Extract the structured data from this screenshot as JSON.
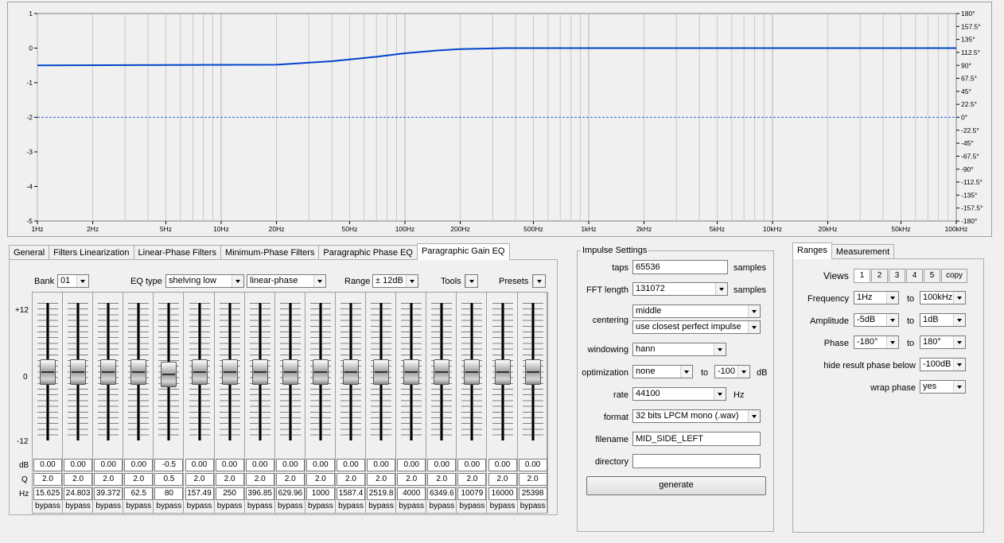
{
  "graph": {
    "y_left_ticks": [
      "1",
      "0",
      "-1",
      "-2",
      "-3",
      "-4",
      "-5"
    ],
    "y_right_ticks": [
      "180°",
      "157.5°",
      "135°",
      "112.5°",
      "90°",
      "67.5°",
      "45°",
      "22.5°",
      "0°",
      "-22.5°",
      "-45°",
      "-67.5°",
      "-90°",
      "-112.5°",
      "-135°",
      "-157.5°",
      "-180°"
    ],
    "x_ticks": [
      {
        "label": "1Hz",
        "hz": 1
      },
      {
        "label": "2Hz",
        "hz": 2
      },
      {
        "label": "5Hz",
        "hz": 5
      },
      {
        "label": "10Hz",
        "hz": 10
      },
      {
        "label": "20Hz",
        "hz": 20
      },
      {
        "label": "50Hz",
        "hz": 50
      },
      {
        "label": "100Hz",
        "hz": 100
      },
      {
        "label": "200Hz",
        "hz": 200
      },
      {
        "label": "500Hz",
        "hz": 500
      },
      {
        "label": "1kHz",
        "hz": 1000
      },
      {
        "label": "2kHz",
        "hz": 2000
      },
      {
        "label": "5kHz",
        "hz": 5000
      },
      {
        "label": "10kHz",
        "hz": 10000
      },
      {
        "label": "20kHz",
        "hz": 20000
      },
      {
        "label": "50kHz",
        "hz": 50000
      },
      {
        "label": "100kHz",
        "hz": 100000
      }
    ],
    "amplitude_curve": [
      [
        1,
        -0.5
      ],
      [
        20,
        -0.48
      ],
      [
        40,
        -0.38
      ],
      [
        70,
        -0.25
      ],
      [
        100,
        -0.15
      ],
      [
        150,
        -0.07
      ],
      [
        200,
        -0.03
      ],
      [
        300,
        -0.01
      ],
      [
        350,
        0
      ],
      [
        100000,
        0
      ]
    ],
    "phase_line_deg": 0,
    "colors": {
      "curve": "#0044cc",
      "phase": "#3366dd",
      "grid": "#c8c8c8",
      "plot_bg": "#f0f0f0"
    }
  },
  "left_tabs": [
    {
      "label": "General",
      "active": false
    },
    {
      "label": "Filters Linearization",
      "active": false
    },
    {
      "label": "Linear-Phase Filters",
      "active": false
    },
    {
      "label": "Minimum-Phase Filters",
      "active": false
    },
    {
      "label": "Paragraphic Phase EQ",
      "active": false
    },
    {
      "label": "Paragraphic Gain EQ",
      "active": true
    }
  ],
  "eq": {
    "bank_label": "Bank",
    "bank_value": "01",
    "eqtype_label": "EQ type",
    "eqtype_value": "shelving low",
    "phase_value": "linear-phase",
    "range_label": "Range",
    "range_value": "± 12dB",
    "tools_label": "Tools",
    "presets_label": "Presets",
    "scale_top": "+12",
    "scale_mid": "0",
    "scale_bottom": "-12",
    "row_db": "dB",
    "row_q": "Q",
    "row_hz": "Hz",
    "bands": [
      {
        "db": "0.00",
        "q": "2.0",
        "hz": "15.625",
        "bypass": "bypass",
        "gain": 0
      },
      {
        "db": "0.00",
        "q": "2.0",
        "hz": "24.803",
        "bypass": "bypass",
        "gain": 0
      },
      {
        "db": "0.00",
        "q": "2.0",
        "hz": "39.372",
        "bypass": "bypass",
        "gain": 0
      },
      {
        "db": "0.00",
        "q": "2.0",
        "hz": "62.5",
        "bypass": "bypass",
        "gain": 0
      },
      {
        "db": "-0.5",
        "q": "0.5",
        "hz": "80",
        "bypass": "bypass",
        "gain": -0.5
      },
      {
        "db": "0.00",
        "q": "2.0",
        "hz": "157.49",
        "bypass": "bypass",
        "gain": 0
      },
      {
        "db": "0.00",
        "q": "2.0",
        "hz": "250",
        "bypass": "bypass",
        "gain": 0
      },
      {
        "db": "0.00",
        "q": "2.0",
        "hz": "396.85",
        "bypass": "bypass",
        "gain": 0
      },
      {
        "db": "0.00",
        "q": "2.0",
        "hz": "629.96",
        "bypass": "bypass",
        "gain": 0
      },
      {
        "db": "0.00",
        "q": "2.0",
        "hz": "1000",
        "bypass": "bypass",
        "gain": 0
      },
      {
        "db": "0.00",
        "q": "2.0",
        "hz": "1587.4",
        "bypass": "bypass",
        "gain": 0
      },
      {
        "db": "0.00",
        "q": "2.0",
        "hz": "2519.8",
        "bypass": "bypass",
        "gain": 0
      },
      {
        "db": "0.00",
        "q": "2.0",
        "hz": "4000",
        "bypass": "bypass",
        "gain": 0
      },
      {
        "db": "0.00",
        "q": "2.0",
        "hz": "6349.6",
        "bypass": "bypass",
        "gain": 0
      },
      {
        "db": "0.00",
        "q": "2.0",
        "hz": "10079",
        "bypass": "bypass",
        "gain": 0
      },
      {
        "db": "0.00",
        "q": "2.0",
        "hz": "16000",
        "bypass": "bypass",
        "gain": 0
      },
      {
        "db": "0.00",
        "q": "2.0",
        "hz": "25398",
        "bypass": "bypass",
        "gain": 0
      }
    ]
  },
  "impulse": {
    "title": "Impulse Settings",
    "taps_label": "taps",
    "taps_value": "65536",
    "taps_unit": "samples",
    "fft_label": "FFT length",
    "fft_value": "131072",
    "fft_unit": "samples",
    "centering_label": "centering",
    "centering_value": "middle",
    "centering_mode": "use closest perfect impulse",
    "windowing_label": "windowing",
    "windowing_value": "hann",
    "optimization_label": "optimization",
    "optimization_value": "none",
    "optimization_to": "to",
    "optimization_level": "-100",
    "optimization_unit": "dB",
    "rate_label": "rate",
    "rate_value": "44100",
    "rate_unit": "Hz",
    "format_label": "format",
    "format_value": "32 bits LPCM mono (.wav)",
    "filename_label": "filename",
    "filename_value": "MID_SIDE_LEFT",
    "directory_label": "directory",
    "directory_value": "",
    "generate_label": "generate"
  },
  "right_tabs": [
    {
      "label": "Ranges",
      "active": true
    },
    {
      "label": "Measurement",
      "active": false
    }
  ],
  "ranges": {
    "views_label": "Views",
    "views": [
      "1",
      "2",
      "3",
      "4",
      "5"
    ],
    "copy_label": "copy",
    "frequency_label": "Frequency",
    "frequency_from": "1Hz",
    "frequency_to": "100kHz",
    "amplitude_label": "Amplitude",
    "amplitude_from": "-5dB",
    "amplitude_to": "1dB",
    "phase_label": "Phase",
    "phase_from": "-180°",
    "phase_to": "180°",
    "to_label": "to",
    "hide_label": "hide result phase below",
    "hide_value": "-100dB",
    "wrap_label": "wrap phase",
    "wrap_value": "yes"
  }
}
